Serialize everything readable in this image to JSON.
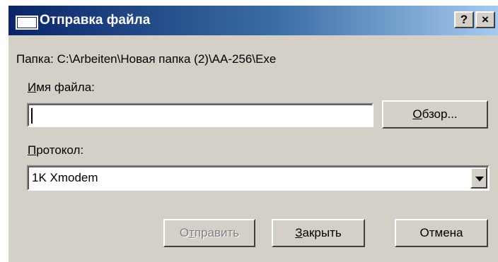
{
  "window": {
    "title": "Отправка файла",
    "help_button": "?",
    "close_button": "×"
  },
  "folder": {
    "text": "Папка: C:\\Arbeiten\\Новая папка (2)\\AA-256\\Exe"
  },
  "filename": {
    "label_accel": "И",
    "label_rest": "мя файла:",
    "value": "",
    "browse_accel": "О",
    "browse_rest": "бзор..."
  },
  "protocol": {
    "label_accel": "П",
    "label_rest": "ротокол:",
    "selected": "1K Xmodem"
  },
  "buttons": {
    "send_pre": "О",
    "send_accel": "т",
    "send_rest": "править",
    "send_enabled": false,
    "close_accel": "З",
    "close_rest": "акрыть",
    "cancel": "Отмена"
  },
  "colors": {
    "title_gradient_start": "#0a246a",
    "title_gradient_end": "#a6caf0",
    "dialog_face": "#d4d0c8"
  }
}
